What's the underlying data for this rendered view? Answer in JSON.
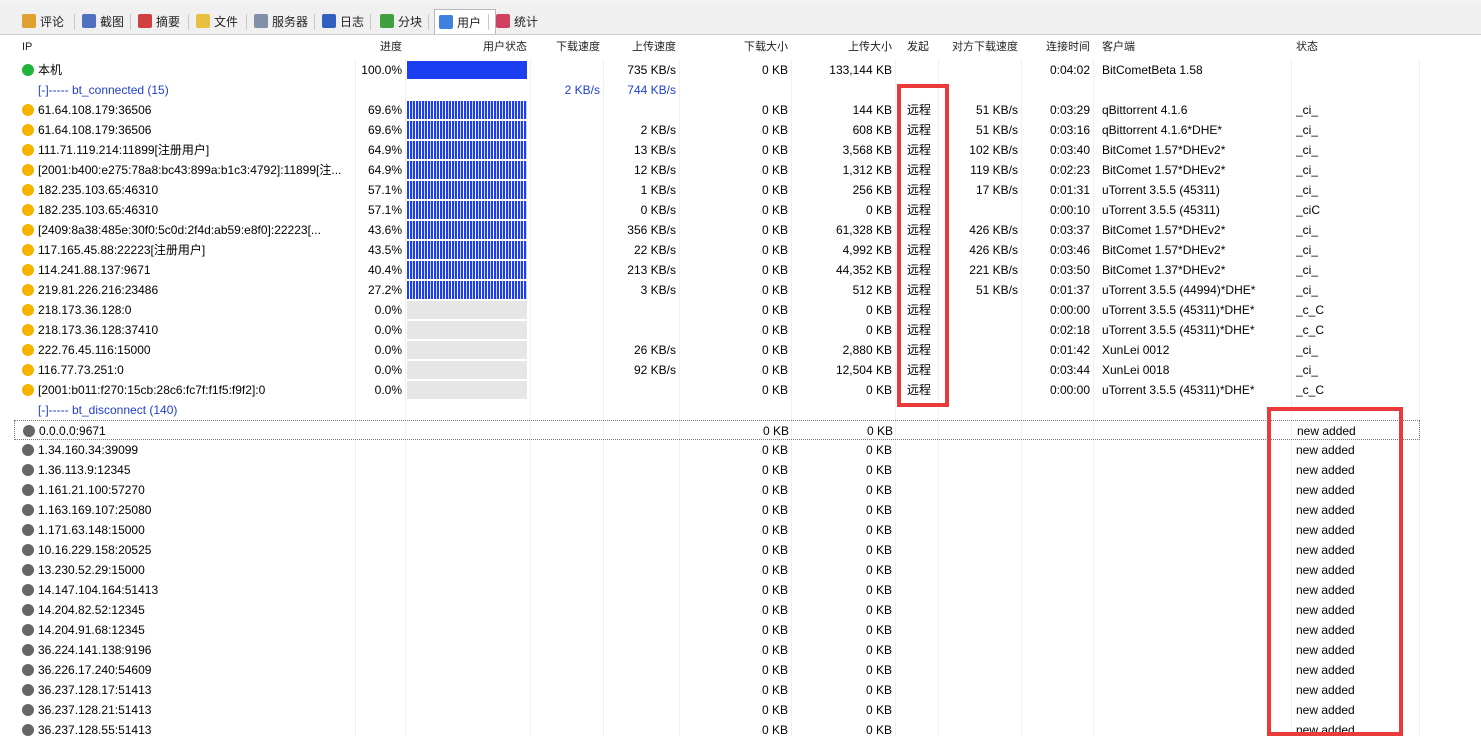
{
  "tabs": [
    {
      "label": "评论",
      "icon": "comment-icon",
      "color": "#e0a030"
    },
    {
      "label": "截图",
      "icon": "screenshot-icon",
      "color": "#5070c0"
    },
    {
      "label": "摘要",
      "icon": "summary-icon",
      "color": "#d04040"
    },
    {
      "label": "文件",
      "icon": "file-icon",
      "color": "#e8c040"
    },
    {
      "label": "服务器",
      "icon": "server-icon",
      "color": "#8090a8"
    },
    {
      "label": "日志",
      "icon": "log-icon",
      "color": "#3060c0"
    },
    {
      "label": "分块",
      "icon": "pieces-icon",
      "color": "#40a040"
    },
    {
      "label": "用户",
      "icon": "user-icon",
      "color": "#4080e0"
    },
    {
      "label": "统计",
      "icon": "stats-icon",
      "color": "#d04060"
    }
  ],
  "columns": [
    "IP",
    "进度",
    "用户状态",
    "下载速度",
    "上传速度",
    "下载大小",
    "上传大小",
    "发起",
    "对方下载速度",
    "连接时间",
    "客户端",
    "状态"
  ],
  "colors": {
    "bar": "#1a3ef0",
    "bar_empty": "#e6e6e6",
    "link": "#1e3fd0",
    "highlight": "#ea3a3a"
  },
  "rows": [
    {
      "kind": "peer",
      "face": "g",
      "ip": "本机",
      "progress": "100.0%",
      "bar": "solid",
      "dl_speed": "",
      "ul_speed": "735 KB/s",
      "dl_size": "0 KB",
      "ul_size": "133,144 KB",
      "init": "",
      "peer_dl": "",
      "time": "0:04:02",
      "client": "BitCometBeta 1.58",
      "status": ""
    },
    {
      "kind": "group",
      "label": "[-]----- bt_connected (15)",
      "dl_speed": "2 KB/s",
      "ul_speed": "744 KB/s"
    },
    {
      "kind": "peer",
      "face": "y",
      "ip": "61.64.108.179:36506",
      "progress": "69.6%",
      "bar": "partial",
      "dl_speed": "",
      "ul_speed": "",
      "dl_size": "0 KB",
      "ul_size": "144 KB",
      "init": "远程",
      "peer_dl": "51 KB/s",
      "time": "0:03:29",
      "client": "qBittorrent 4.1.6",
      "status": "_ci_"
    },
    {
      "kind": "peer",
      "face": "y",
      "ip": "61.64.108.179:36506",
      "progress": "69.6%",
      "bar": "partial",
      "dl_speed": "",
      "ul_speed": "2 KB/s",
      "dl_size": "0 KB",
      "ul_size": "608 KB",
      "init": "远程",
      "peer_dl": "51 KB/s",
      "time": "0:03:16",
      "client": "qBittorrent 4.1.6*DHE*",
      "status": "_ci_"
    },
    {
      "kind": "peer",
      "face": "y",
      "ip": "111.71.119.214:11899[注册用户]",
      "progress": "64.9%",
      "bar": "partial",
      "dl_speed": "",
      "ul_speed": "13 KB/s",
      "dl_size": "0 KB",
      "ul_size": "3,568 KB",
      "init": "远程",
      "peer_dl": "102 KB/s",
      "time": "0:03:40",
      "client": "BitComet 1.57*DHEv2*",
      "status": "_ci_"
    },
    {
      "kind": "peer",
      "face": "y",
      "ip": "[2001:b400:e275:78a8:bc43:899a:b1c3:4792]:11899[注...",
      "progress": "64.9%",
      "bar": "partial",
      "dl_speed": "",
      "ul_speed": "12 KB/s",
      "dl_size": "0 KB",
      "ul_size": "1,312 KB",
      "init": "远程",
      "peer_dl": "119 KB/s",
      "time": "0:02:23",
      "client": "BitComet 1.57*DHEv2*",
      "status": "_ci_"
    },
    {
      "kind": "peer",
      "face": "y",
      "ip": "182.235.103.65:46310",
      "progress": "57.1%",
      "bar": "partial",
      "dl_speed": "",
      "ul_speed": "1 KB/s",
      "dl_size": "0 KB",
      "ul_size": "256 KB",
      "init": "远程",
      "peer_dl": "17 KB/s",
      "time": "0:01:31",
      "client": "uTorrent 3.5.5 (45311)",
      "status": "_ci_"
    },
    {
      "kind": "peer",
      "face": "y",
      "ip": "182.235.103.65:46310",
      "progress": "57.1%",
      "bar": "partial",
      "dl_speed": "",
      "ul_speed": "0 KB/s",
      "dl_size": "0 KB",
      "ul_size": "0 KB",
      "init": "远程",
      "peer_dl": "",
      "time": "0:00:10",
      "client": "uTorrent 3.5.5 (45311)",
      "status": "_ciC"
    },
    {
      "kind": "peer",
      "face": "y",
      "ip": "[2409:8a38:485e:30f0:5c0d:2f4d:ab59:e8f0]:22223[...",
      "progress": "43.6%",
      "bar": "partial",
      "dl_speed": "",
      "ul_speed": "356 KB/s",
      "dl_size": "0 KB",
      "ul_size": "61,328 KB",
      "init": "远程",
      "peer_dl": "426 KB/s",
      "time": "0:03:37",
      "client": "BitComet 1.57*DHEv2*",
      "status": "_ci_"
    },
    {
      "kind": "peer",
      "face": "y",
      "ip": "117.165.45.88:22223[注册用户]",
      "progress": "43.5%",
      "bar": "partial",
      "dl_speed": "",
      "ul_speed": "22 KB/s",
      "dl_size": "0 KB",
      "ul_size": "4,992 KB",
      "init": "远程",
      "peer_dl": "426 KB/s",
      "time": "0:03:46",
      "client": "BitComet 1.57*DHEv2*",
      "status": "_ci_"
    },
    {
      "kind": "peer",
      "face": "y",
      "ip": "114.241.88.137:9671",
      "progress": "40.4%",
      "bar": "partial",
      "dl_speed": "",
      "ul_speed": "213 KB/s",
      "dl_size": "0 KB",
      "ul_size": "44,352 KB",
      "init": "远程",
      "peer_dl": "221 KB/s",
      "time": "0:03:50",
      "client": "BitComet 1.37*DHEv2*",
      "status": "_ci_"
    },
    {
      "kind": "peer",
      "face": "y",
      "ip": "219.81.226.216:23486",
      "progress": "27.2%",
      "bar": "partial",
      "dl_speed": "",
      "ul_speed": "3 KB/s",
      "dl_size": "0 KB",
      "ul_size": "512 KB",
      "init": "远程",
      "peer_dl": "51 KB/s",
      "time": "0:01:37",
      "client": "uTorrent 3.5.5 (44994)*DHE*",
      "status": "_ci_"
    },
    {
      "kind": "peer",
      "face": "y",
      "ip": "218.173.36.128:0",
      "progress": "0.0%",
      "bar": "empty",
      "dl_speed": "",
      "ul_speed": "",
      "dl_size": "0 KB",
      "ul_size": "0 KB",
      "init": "远程",
      "peer_dl": "",
      "time": "0:00:00",
      "client": "uTorrent 3.5.5 (45311)*DHE*",
      "status": "_c_C"
    },
    {
      "kind": "peer",
      "face": "y",
      "ip": "218.173.36.128:37410",
      "progress": "0.0%",
      "bar": "empty",
      "dl_speed": "",
      "ul_speed": "",
      "dl_size": "0 KB",
      "ul_size": "0 KB",
      "init": "远程",
      "peer_dl": "",
      "time": "0:02:18",
      "client": "uTorrent 3.5.5 (45311)*DHE*",
      "status": "_c_C"
    },
    {
      "kind": "peer",
      "face": "y",
      "ip": "222.76.45.116:15000",
      "progress": "0.0%",
      "bar": "empty",
      "dl_speed": "",
      "ul_speed": "26 KB/s",
      "dl_size": "0 KB",
      "ul_size": "2,880 KB",
      "init": "远程",
      "peer_dl": "",
      "time": "0:01:42",
      "client": "XunLei 0012",
      "status": "_ci_"
    },
    {
      "kind": "peer",
      "face": "y",
      "ip": "116.77.73.251:0",
      "progress": "0.0%",
      "bar": "empty",
      "dl_speed": "",
      "ul_speed": "92 KB/s",
      "dl_size": "0 KB",
      "ul_size": "12,504 KB",
      "init": "远程",
      "peer_dl": "",
      "time": "0:03:44",
      "client": "XunLei 0018",
      "status": "_ci_"
    },
    {
      "kind": "peer",
      "face": "y",
      "ip": "[2001:b011:f270:15cb:28c6:fc7f:f1f5:f9f2]:0",
      "progress": "0.0%",
      "bar": "empty",
      "dl_speed": "",
      "ul_speed": "",
      "dl_size": "0 KB",
      "ul_size": "0 KB",
      "init": "远程",
      "peer_dl": "",
      "time": "0:00:00",
      "client": "uTorrent 3.5.5 (45311)*DHE*",
      "status": "_c_C"
    },
    {
      "kind": "group",
      "label": "[-]----- bt_disconnect (140)",
      "dl_speed": "",
      "ul_speed": ""
    },
    {
      "kind": "peer",
      "face": "d",
      "sel": true,
      "ip": "0.0.0.0:9671",
      "progress": "",
      "bar": "none",
      "dl_speed": "",
      "ul_speed": "",
      "dl_size": "0 KB",
      "ul_size": "0 KB",
      "init": "",
      "peer_dl": "",
      "time": "",
      "client": "",
      "status": "new added"
    },
    {
      "kind": "peer",
      "face": "d",
      "ip": "1.34.160.34:39099",
      "progress": "",
      "bar": "none",
      "dl_speed": "",
      "ul_speed": "",
      "dl_size": "0 KB",
      "ul_size": "0 KB",
      "init": "",
      "peer_dl": "",
      "time": "",
      "client": "",
      "status": "new added"
    },
    {
      "kind": "peer",
      "face": "d",
      "ip": "1.36.113.9:12345",
      "progress": "",
      "bar": "none",
      "dl_speed": "",
      "ul_speed": "",
      "dl_size": "0 KB",
      "ul_size": "0 KB",
      "init": "",
      "peer_dl": "",
      "time": "",
      "client": "",
      "status": "new added"
    },
    {
      "kind": "peer",
      "face": "d",
      "ip": "1.161.21.100:57270",
      "progress": "",
      "bar": "none",
      "dl_speed": "",
      "ul_speed": "",
      "dl_size": "0 KB",
      "ul_size": "0 KB",
      "init": "",
      "peer_dl": "",
      "time": "",
      "client": "",
      "status": "new added"
    },
    {
      "kind": "peer",
      "face": "d",
      "ip": "1.163.169.107:25080",
      "progress": "",
      "bar": "none",
      "dl_speed": "",
      "ul_speed": "",
      "dl_size": "0 KB",
      "ul_size": "0 KB",
      "init": "",
      "peer_dl": "",
      "time": "",
      "client": "",
      "status": "new added"
    },
    {
      "kind": "peer",
      "face": "d",
      "ip": "1.171.63.148:15000",
      "progress": "",
      "bar": "none",
      "dl_speed": "",
      "ul_speed": "",
      "dl_size": "0 KB",
      "ul_size": "0 KB",
      "init": "",
      "peer_dl": "",
      "time": "",
      "client": "",
      "status": "new added"
    },
    {
      "kind": "peer",
      "face": "d",
      "ip": "10.16.229.158:20525",
      "progress": "",
      "bar": "none",
      "dl_speed": "",
      "ul_speed": "",
      "dl_size": "0 KB",
      "ul_size": "0 KB",
      "init": "",
      "peer_dl": "",
      "time": "",
      "client": "",
      "status": "new added"
    },
    {
      "kind": "peer",
      "face": "d",
      "ip": "13.230.52.29:15000",
      "progress": "",
      "bar": "none",
      "dl_speed": "",
      "ul_speed": "",
      "dl_size": "0 KB",
      "ul_size": "0 KB",
      "init": "",
      "peer_dl": "",
      "time": "",
      "client": "",
      "status": "new added"
    },
    {
      "kind": "peer",
      "face": "d",
      "ip": "14.147.104.164:51413",
      "progress": "",
      "bar": "none",
      "dl_speed": "",
      "ul_speed": "",
      "dl_size": "0 KB",
      "ul_size": "0 KB",
      "init": "",
      "peer_dl": "",
      "time": "",
      "client": "",
      "status": "new added"
    },
    {
      "kind": "peer",
      "face": "d",
      "ip": "14.204.82.52:12345",
      "progress": "",
      "bar": "none",
      "dl_speed": "",
      "ul_speed": "",
      "dl_size": "0 KB",
      "ul_size": "0 KB",
      "init": "",
      "peer_dl": "",
      "time": "",
      "client": "",
      "status": "new added"
    },
    {
      "kind": "peer",
      "face": "d",
      "ip": "14.204.91.68:12345",
      "progress": "",
      "bar": "none",
      "dl_speed": "",
      "ul_speed": "",
      "dl_size": "0 KB",
      "ul_size": "0 KB",
      "init": "",
      "peer_dl": "",
      "time": "",
      "client": "",
      "status": "new added"
    },
    {
      "kind": "peer",
      "face": "d",
      "ip": "36.224.141.138:9196",
      "progress": "",
      "bar": "none",
      "dl_speed": "",
      "ul_speed": "",
      "dl_size": "0 KB",
      "ul_size": "0 KB",
      "init": "",
      "peer_dl": "",
      "time": "",
      "client": "",
      "status": "new added"
    },
    {
      "kind": "peer",
      "face": "d",
      "ip": "36.226.17.240:54609",
      "progress": "",
      "bar": "none",
      "dl_speed": "",
      "ul_speed": "",
      "dl_size": "0 KB",
      "ul_size": "0 KB",
      "init": "",
      "peer_dl": "",
      "time": "",
      "client": "",
      "status": "new added"
    },
    {
      "kind": "peer",
      "face": "d",
      "ip": "36.237.128.17:51413",
      "progress": "",
      "bar": "none",
      "dl_speed": "",
      "ul_speed": "",
      "dl_size": "0 KB",
      "ul_size": "0 KB",
      "init": "",
      "peer_dl": "",
      "time": "",
      "client": "",
      "status": "new added"
    },
    {
      "kind": "peer",
      "face": "d",
      "ip": "36.237.128.21:51413",
      "progress": "",
      "bar": "none",
      "dl_speed": "",
      "ul_speed": "",
      "dl_size": "0 KB",
      "ul_size": "0 KB",
      "init": "",
      "peer_dl": "",
      "time": "",
      "client": "",
      "status": "new added"
    },
    {
      "kind": "peer",
      "face": "d",
      "ip": "36.237.128.55:51413",
      "progress": "",
      "bar": "none",
      "dl_speed": "",
      "ul_speed": "",
      "dl_size": "0 KB",
      "ul_size": "0 KB",
      "init": "",
      "peer_dl": "",
      "time": "",
      "client": "",
      "status": "new added"
    }
  ]
}
